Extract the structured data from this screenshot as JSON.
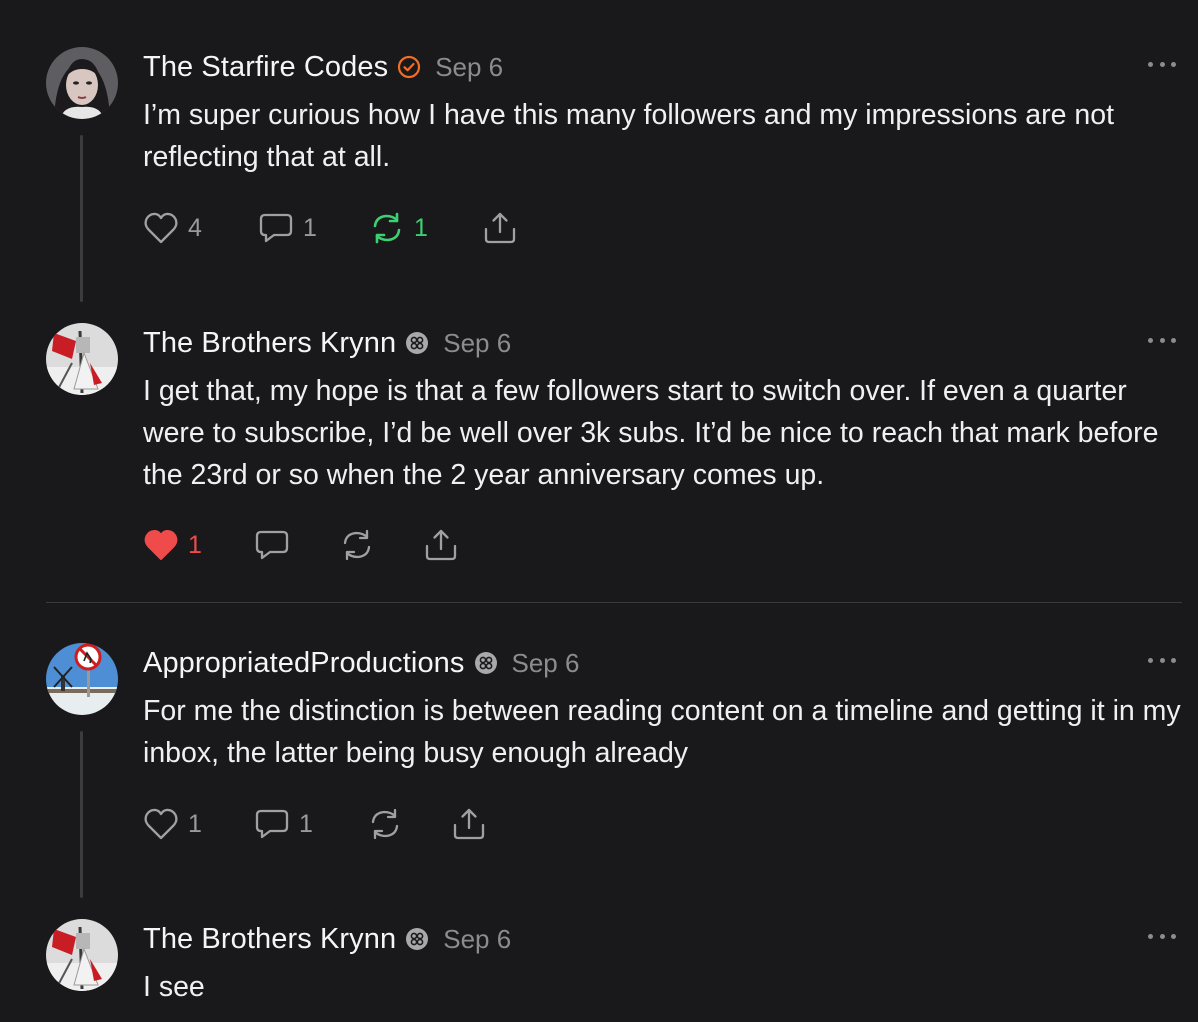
{
  "posts": [
    {
      "author": "The Starfire Codes",
      "badge_icon": "verified-check-icon",
      "badge_color": "#f26e21",
      "date": "Sep 6",
      "body": "I’m super curious how I have this many followers and my impressions are not reflecting that at all.",
      "likes": "4",
      "comments": "1",
      "restacks": "1",
      "restacked": true,
      "liked": false
    },
    {
      "author": "The Brothers Krynn",
      "badge_icon": "substack-badge-icon",
      "date": "Sep 6",
      "body": "I get that, my hope is that a few followers start to switch over. If even a quarter were to subscribe, I’d be well over 3k subs. It’d be nice to reach that mark before the 23rd or so when the 2 year anniversary comes up.",
      "likes": "1",
      "comments": "",
      "restacks": "",
      "liked": true
    },
    {
      "author": "AppropriatedProductions",
      "badge_icon": "substack-badge-icon",
      "date": "Sep 6",
      "body": "For me the distinction is between reading content on a timeline and getting it in my inbox, the latter being busy enough already",
      "likes": "1",
      "comments": "1",
      "restacks": "",
      "liked": false
    },
    {
      "author": "The Brothers Krynn",
      "badge_icon": "substack-badge-icon",
      "date": "Sep 6",
      "body": "I see"
    }
  ],
  "colors": {
    "background": "#19191b",
    "restack_active": "#3dcf73",
    "like_active": "#ef4b4b",
    "muted": "#8c8c90"
  }
}
